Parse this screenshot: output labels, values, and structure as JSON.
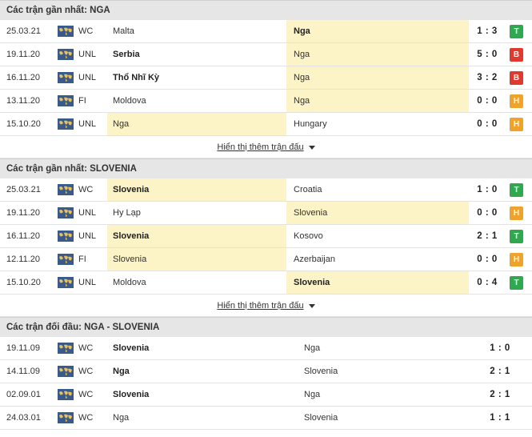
{
  "sections": [
    {
      "title": "Các trận gần nhất: NGA",
      "more_label": "Hiển thị thêm trận đấu",
      "matches": [
        {
          "date": "25.03.21",
          "comp": "WC",
          "home": "Malta",
          "away": "Nga",
          "score": "1 : 3",
          "result": "T",
          "hl": "away",
          "bold": "away"
        },
        {
          "date": "19.11.20",
          "comp": "UNL",
          "home": "Serbia",
          "away": "Nga",
          "score": "5 : 0",
          "result": "B",
          "hl": "away",
          "bold": "home"
        },
        {
          "date": "16.11.20",
          "comp": "UNL",
          "home": "Thổ Nhĩ Kỳ",
          "away": "Nga",
          "score": "3 : 2",
          "result": "B",
          "hl": "away",
          "bold": "home"
        },
        {
          "date": "13.11.20",
          "comp": "FI",
          "home": "Moldova",
          "away": "Nga",
          "score": "0 : 0",
          "result": "H",
          "hl": "away",
          "bold": ""
        },
        {
          "date": "15.10.20",
          "comp": "UNL",
          "home": "Nga",
          "away": "Hungary",
          "score": "0 : 0",
          "result": "H",
          "hl": "home",
          "bold": ""
        }
      ]
    },
    {
      "title": "Các trận gần nhất: SLOVENIA",
      "more_label": "Hiển thị thêm trận đấu",
      "matches": [
        {
          "date": "25.03.21",
          "comp": "WC",
          "home": "Slovenia",
          "away": "Croatia",
          "score": "1 : 0",
          "result": "T",
          "hl": "home",
          "bold": "home"
        },
        {
          "date": "19.11.20",
          "comp": "UNL",
          "home": "Hy Lạp",
          "away": "Slovenia",
          "score": "0 : 0",
          "result": "H",
          "hl": "away",
          "bold": ""
        },
        {
          "date": "16.11.20",
          "comp": "UNL",
          "home": "Slovenia",
          "away": "Kosovo",
          "score": "2 : 1",
          "result": "T",
          "hl": "home",
          "bold": "home"
        },
        {
          "date": "12.11.20",
          "comp": "FI",
          "home": "Slovenia",
          "away": "Azerbaijan",
          "score": "0 : 0",
          "result": "H",
          "hl": "home",
          "bold": ""
        },
        {
          "date": "15.10.20",
          "comp": "UNL",
          "home": "Moldova",
          "away": "Slovenia",
          "score": "0 : 4",
          "result": "T",
          "hl": "away",
          "bold": "away"
        }
      ]
    }
  ],
  "h2h": {
    "title": "Các trận đối đầu: NGA - SLOVENIA",
    "matches": [
      {
        "date": "19.11.09",
        "comp": "WC",
        "home": "Slovenia",
        "away": "Nga",
        "score": "1 : 0",
        "bold": "home"
      },
      {
        "date": "14.11.09",
        "comp": "WC",
        "home": "Nga",
        "away": "Slovenia",
        "score": "2 : 1",
        "bold": "home"
      },
      {
        "date": "02.09.01",
        "comp": "WC",
        "home": "Slovenia",
        "away": "Nga",
        "score": "2 : 1",
        "bold": "home"
      },
      {
        "date": "24.03.01",
        "comp": "WC",
        "home": "Nga",
        "away": "Slovenia",
        "score": "1 : 1",
        "bold": ""
      }
    ]
  },
  "colors": {
    "win": "#2fa84f",
    "loss": "#e03a2f",
    "draw": "#f0a32a",
    "highlight": "#fcf3c6",
    "header_bg": "#e6e6e6"
  },
  "icons": {
    "competition": "world-map-icon",
    "expand": "caret-down-icon"
  }
}
